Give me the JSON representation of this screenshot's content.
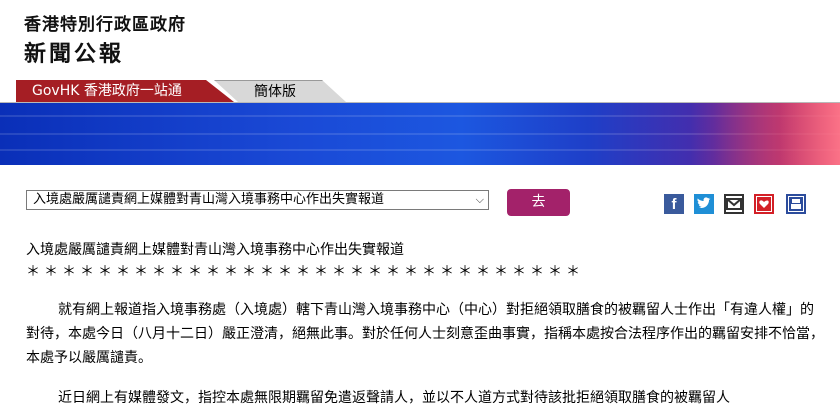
{
  "header": {
    "gov_name": "香港特別行政區政府",
    "press_title": "新聞公報"
  },
  "tabs": {
    "govhk": "GovHK 香港政府一站通",
    "simplified": "簡体版"
  },
  "toolbar": {
    "selected_article": "入境處嚴厲譴責網上媒體對青山灣入境事務中心作出失實報道",
    "go_label": "去",
    "share_icons": [
      "facebook-icon",
      "twitter-icon",
      "email-icon",
      "bookmark-icon",
      "print-icon"
    ],
    "facebook_glyph": "f"
  },
  "article": {
    "headline": "入境處嚴厲譴責網上媒體對青山灣入境事務中心作出失實報道",
    "separator": "＊＊＊＊＊＊＊＊＊＊＊＊＊＊＊＊＊＊＊＊＊＊＊＊＊＊＊＊＊＊＊",
    "paragraph1": "就有網上報道指入境事務處（入境處）轄下青山灣入境事務中心（中心）對拒絕領取膳食的被羈留人士作出「有違人權」的對待，本處今日（八月十二日）嚴正澄清，絕無此事。對於任何人士刻意歪曲事實，指稱本處按合法程序作出的羈留安排不恰當，本處予以嚴厲譴責。",
    "paragraph2": "近日網上有媒體發文，指控本處無限期羈留免遣返聲請人，並以不人道方式對待該批拒絕領取膳食的被羈留人"
  },
  "colors": {
    "govhk_tab": "#a51e24",
    "go_button": "#a3226a",
    "banner_blue": "#1a49d6"
  }
}
